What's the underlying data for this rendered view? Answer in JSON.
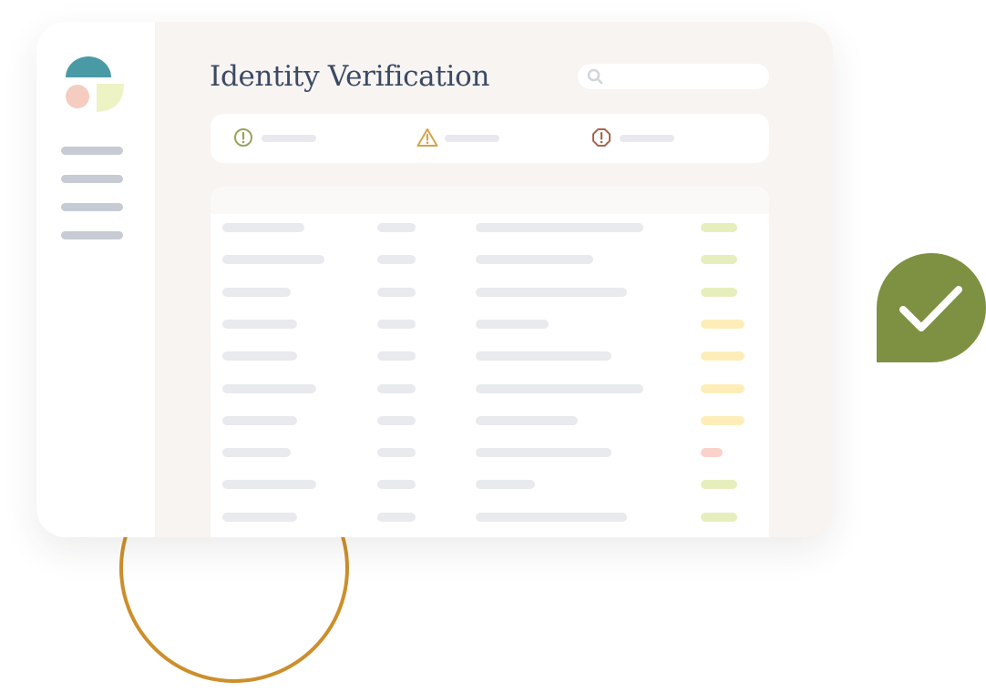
{
  "header": {
    "title": "Identity Verification"
  },
  "search": {
    "value": "",
    "placeholder": "",
    "icon": "search-icon"
  },
  "summary": [
    {
      "icon": "info-circle-icon",
      "color": "#9aa25c"
    },
    {
      "icon": "warning-triangle-icon",
      "color": "#d5a34c"
    },
    {
      "icon": "error-octagon-icon",
      "color": "#a9654c"
    }
  ],
  "sidebar": {
    "item_count": 4
  },
  "table": {
    "rows": [
      {
        "status": "verified"
      },
      {
        "status": "verified"
      },
      {
        "status": "verified"
      },
      {
        "status": "pending"
      },
      {
        "status": "pending"
      },
      {
        "status": "pending"
      },
      {
        "status": "pending"
      },
      {
        "status": "failed"
      },
      {
        "status": "verified"
      },
      {
        "status": "verified"
      }
    ]
  },
  "colors": {
    "verified": "#e7eebd",
    "pending": "#fdeeb9",
    "failed": "#fad1cb",
    "accent_teal": "#4a9aa5",
    "accent_olive": "#7e9142",
    "accent_gold": "#cc8f2c",
    "title_text": "#3b4a64"
  },
  "badge": {
    "icon": "checkmark-icon"
  }
}
